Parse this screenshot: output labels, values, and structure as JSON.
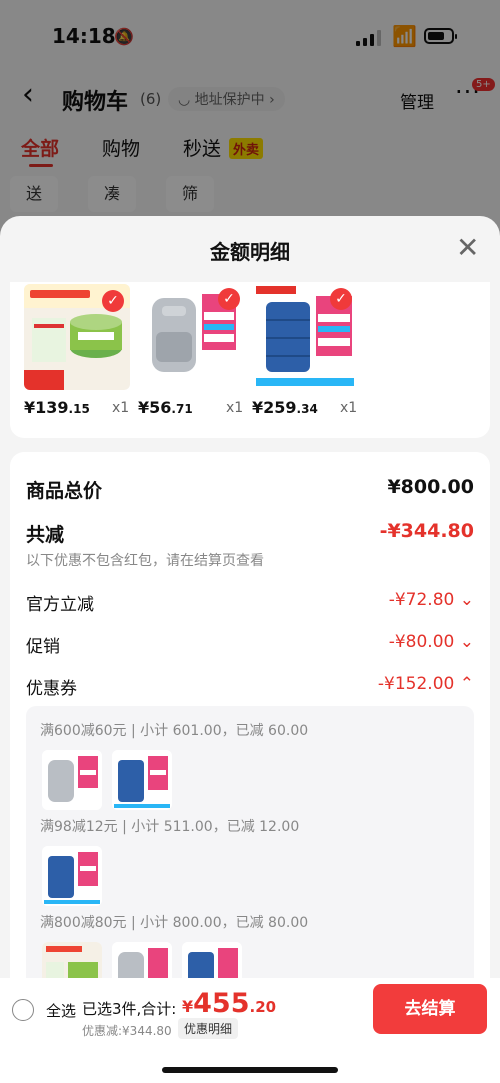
{
  "status_bar": {
    "time": "14:18"
  },
  "header": {
    "title": "购物车",
    "count": "(6)",
    "address": "地址保护中",
    "manage": "管理",
    "more_badge": "5+"
  },
  "tabs": [
    {
      "label": "全部"
    },
    {
      "label": "购物"
    },
    {
      "label": "秒送"
    }
  ],
  "tab_badge": "外卖",
  "chips": [
    "送礼",
    "凑单",
    "筛选"
  ],
  "sheet": {
    "title": "金额明细"
  },
  "products": [
    {
      "price_int": "¥139",
      "price_dec": ".15",
      "qty": "x1"
    },
    {
      "price_int": "¥56",
      "price_dec": ".71",
      "qty": "x1"
    },
    {
      "price_int": "¥259",
      "price_dec": ".34",
      "qty": "x1"
    }
  ],
  "summary": {
    "total_label": "商品总价",
    "total_value": "¥800.00",
    "reduce_label": "共减",
    "reduce_value": "-¥344.80",
    "note": "以下优惠不包含红包，请在结算页查看",
    "official_label": "官方立减",
    "official_value": "-¥72.80",
    "promo_label": "促销",
    "promo_value": "-¥80.00",
    "coupon_label": "优惠券",
    "coupon_value": "-¥152.00"
  },
  "coupon_details": [
    {
      "rule": "满600减60元",
      "subtotal": "小计 601.00，已减 60.00"
    },
    {
      "rule": "满98减12元",
      "subtotal": "小计 511.00，已减 12.00"
    },
    {
      "rule": "满800减80元",
      "subtotal": "小计 800.00，已减 80.00"
    }
  ],
  "bottom": {
    "select_all": "全选",
    "selected": "已选3件,合计:",
    "total_yen": "¥",
    "total_int": "455",
    "total_dec": ".20",
    "discount": "优惠减:¥344.80",
    "detail_button": "优惠明细",
    "checkout": "去结算"
  },
  "colors": {
    "accent": "#e4322b",
    "checkout": "#f23c3c"
  }
}
